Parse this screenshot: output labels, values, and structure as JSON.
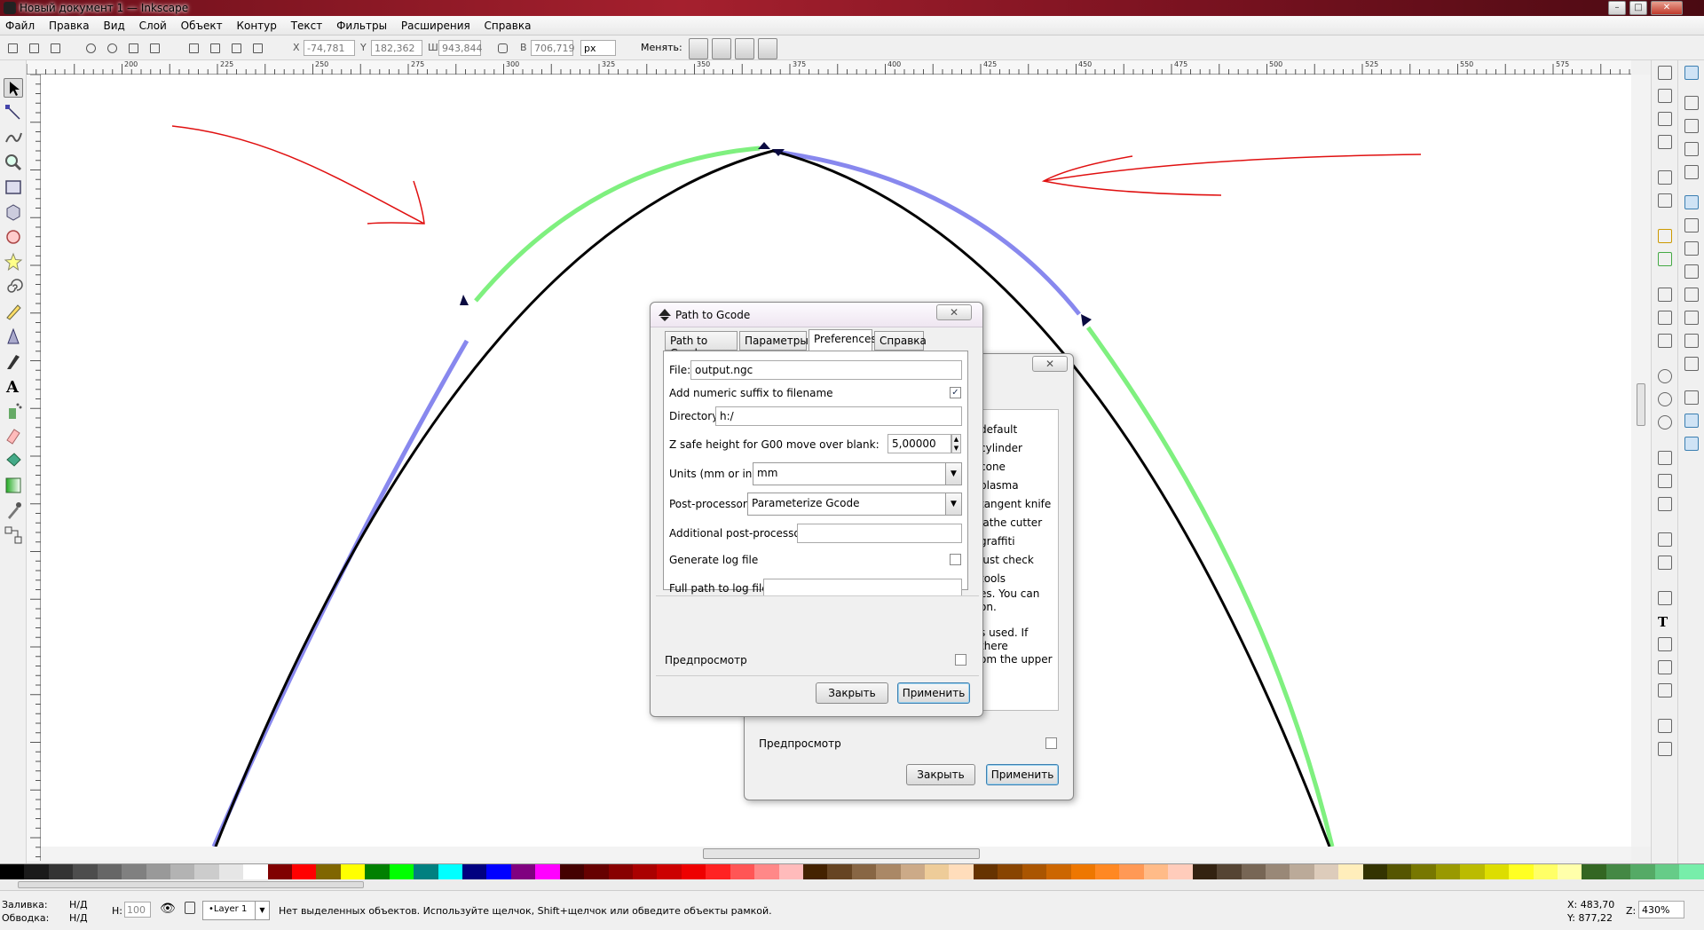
{
  "window": {
    "title": "Новый документ 1 — Inkscape"
  },
  "menu": [
    "Файл",
    "Правка",
    "Вид",
    "Слой",
    "Объект",
    "Контур",
    "Текст",
    "Фильтры",
    "Расширения",
    "Справка"
  ],
  "toolbar": {
    "x_label": "X",
    "x_value": "-74,781",
    "y_label": "Y",
    "y_value": "182,362",
    "w_label": "Ш",
    "w_value": "943,844",
    "h_label": "В",
    "h_value": "706,719",
    "unit": "px",
    "change_label": "Менять:"
  },
  "ruler": {
    "marks": [
      "200",
      "225",
      "250",
      "275",
      "300",
      "325",
      "350",
      "375",
      "400",
      "425",
      "450",
      "475",
      "500",
      "525",
      "550",
      "575"
    ]
  },
  "front_dialog": {
    "title": "Path to Gcode",
    "tabs": [
      "Path to Gcode",
      "Параметры",
      "Preferences",
      "Справка"
    ],
    "active_tab": "Preferences",
    "file_label": "File:",
    "file_value": "output.ngc",
    "suffix_label": "Add numeric suffix to filename",
    "dir_label": "Directory:",
    "dir_value": "h:/",
    "zsafe_label": "Z safe height for G00 move over blank:",
    "zsafe_value": "5,00000",
    "units_label": "Units (mm or in):",
    "units_value": "mm",
    "post_label": "Post-processor:",
    "post_value": "Parameterize Gcode",
    "addpost_label": "Additional post-processor:",
    "addpost_value": "",
    "log_label": "Generate log file",
    "logpath_label": "Full path to log file:",
    "logpath_value": "",
    "preview_label": "Предпросмотр",
    "close_label": "Закрыть",
    "apply_label": "Применить"
  },
  "back_dialog": {
    "list_items": [
      "default",
      "cylinder",
      "cone",
      "plasma",
      "tangent knife",
      "lathe cutter",
      "graffiti",
      "just check tools"
    ],
    "help_lines": [
      "es. You can",
      "on.",
      "s used. If there",
      "om the upper"
    ],
    "preview_label": "Предпросмотр",
    "close_label": "Закрыть",
    "apply_label": "Применить"
  },
  "status": {
    "fill_label": "Заливка:",
    "fill_value": "Н/Д",
    "stroke_label": "Обводка:",
    "stroke_value": "Н/Д",
    "h_label": "Н:",
    "h_value": "100",
    "layer": "•Layer 1",
    "message": "Нет выделенных объектов. Используйте щелчок, Shift+щелчок или обведите объекты рамкой.",
    "x_coord": "X: 483,70",
    "y_coord": "Y: 877,22",
    "zoom_label": "Z:",
    "zoom_value": "430%"
  },
  "colors": {
    "accent": "#3c7fb1",
    "green_path": "#7ff07f",
    "blue_path": "#8888ee",
    "annotation_red": "#e01010"
  }
}
